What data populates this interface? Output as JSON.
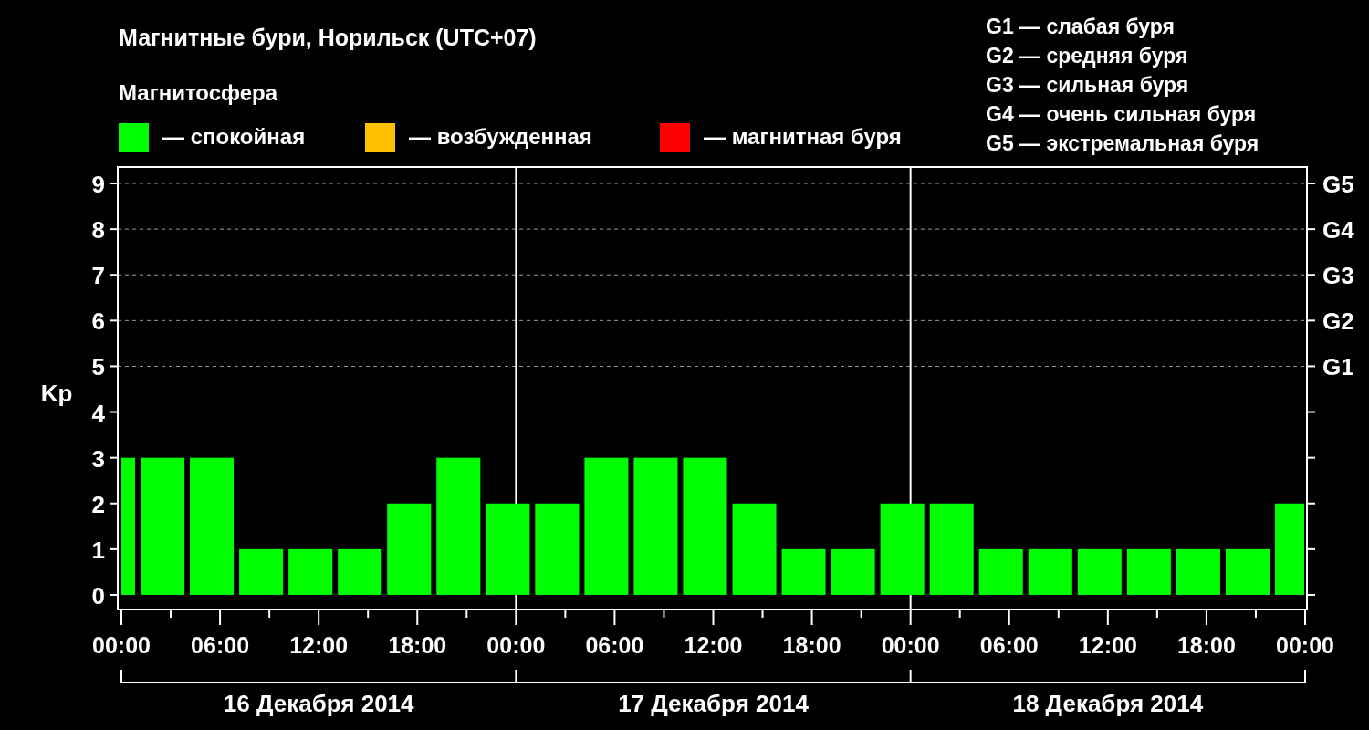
{
  "title": "Магнитные бури, Норильск (UTC+07)",
  "legend": {
    "title": "Магнитосфера",
    "items": [
      {
        "label": "— спокойная",
        "color": "#00ff00"
      },
      {
        "label": "— возбужденная",
        "color": "#ffc000"
      },
      {
        "label": "— магнитная буря",
        "color": "#ff0000"
      }
    ]
  },
  "storm_scale": [
    "G1 — слабая буря",
    "G2 — средняя буря",
    "G3 — сильная буря",
    "G4 — очень сильная буря",
    "G5 — экстремальная буря"
  ],
  "chart": {
    "chart_data": {
      "type": "bar",
      "ylabel": "Kp",
      "x": [
        "2014-12-16T00:40",
        "2014-12-16T02:30",
        "2014-12-16T05:30",
        "2014-12-16T08:30",
        "2014-12-16T11:30",
        "2014-12-16T14:30",
        "2014-12-16T17:30",
        "2014-12-16T20:30",
        "2014-12-16T23:30",
        "2014-12-17T02:30",
        "2014-12-17T05:30",
        "2014-12-17T08:30",
        "2014-12-17T11:30",
        "2014-12-17T14:30",
        "2014-12-17T17:30",
        "2014-12-17T20:30",
        "2014-12-17T23:30",
        "2014-12-18T02:30",
        "2014-12-18T05:30",
        "2014-12-18T08:30",
        "2014-12-18T11:30",
        "2014-12-18T14:30",
        "2014-12-18T17:30",
        "2014-12-18T20:30",
        "2014-12-18T23:05"
      ],
      "values": [
        3,
        3,
        3,
        1,
        1,
        1,
        2,
        3,
        2,
        2,
        3,
        3,
        3,
        2,
        1,
        1,
        2,
        2,
        1,
        1,
        1,
        1,
        1,
        1,
        2
      ],
      "xlim": [
        "2014-12-16T00:00",
        "2014-12-19T00:00"
      ],
      "ylim": [
        -0.32,
        9.36
      ],
      "xticks": [
        {
          "value": "2014-12-16T00:00",
          "label": "00:00"
        },
        {
          "value": "2014-12-16T06:00",
          "label": "06:00"
        },
        {
          "value": "2014-12-16T12:00",
          "label": "12:00"
        },
        {
          "value": "2014-12-16T18:00",
          "label": "18:00"
        },
        {
          "value": "2014-12-17T00:00",
          "label": "00:00"
        },
        {
          "value": "2014-12-17T06:00",
          "label": "06:00"
        },
        {
          "value": "2014-12-17T12:00",
          "label": "12:00"
        },
        {
          "value": "2014-12-17T18:00",
          "label": "18:00"
        },
        {
          "value": "2014-12-18T00:00",
          "label": "00:00"
        },
        {
          "value": "2014-12-18T06:00",
          "label": "06:00"
        },
        {
          "value": "2014-12-18T12:00",
          "label": "12:00"
        },
        {
          "value": "2014-12-18T18:00",
          "label": "18:00"
        },
        {
          "value": "2014-12-19T00:00",
          "label": "00:00"
        }
      ],
      "yticks": [
        0,
        1,
        2,
        3,
        4,
        5,
        6,
        7,
        8,
        9
      ],
      "grid": true
    },
    "right_axis_labels": [
      "G5",
      "G4",
      "G3",
      "G2",
      "G1"
    ],
    "day_labels": [
      "16 Декабря 2014",
      "17 Декабря 2014",
      "18 Декабря 2014"
    ]
  }
}
